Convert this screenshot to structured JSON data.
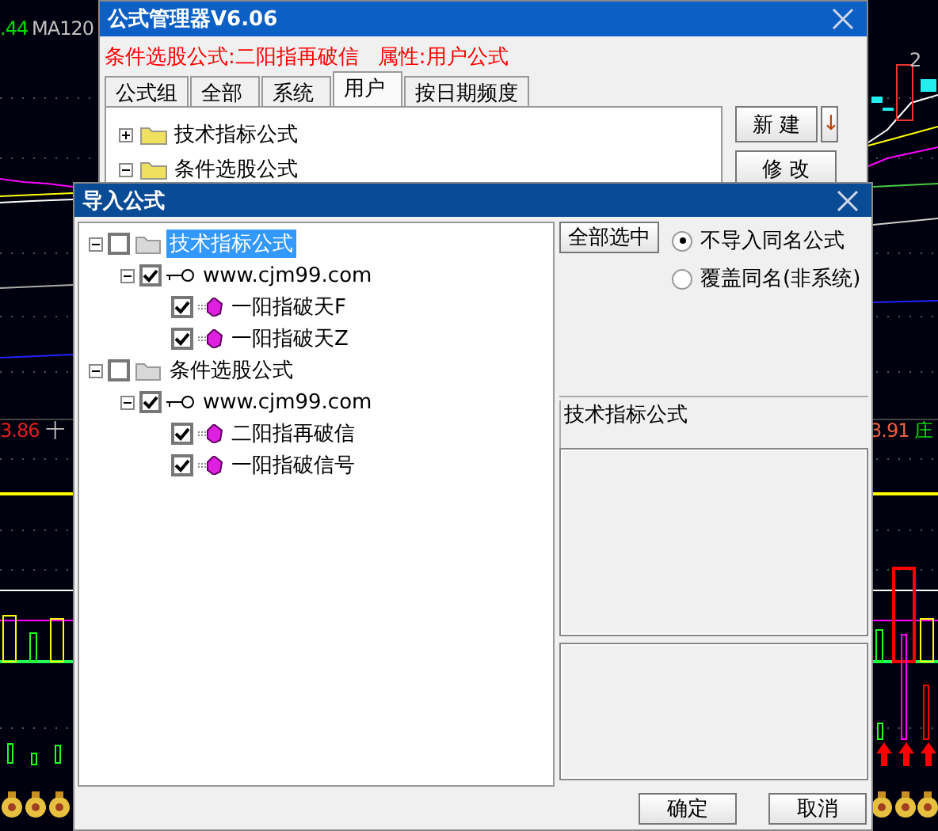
{
  "chart": {
    "labels": [
      {
        "text": ".44",
        "color": "#00e000"
      },
      {
        "text": "MA120",
        "color": "#c0c0c0"
      },
      {
        "text": "2",
        "color": "#c0c0c0"
      },
      {
        "text": "3.86",
        "color": "#e02020"
      },
      {
        "text": "十",
        "color": "#c0c0c0"
      },
      {
        "text": "3.91",
        "color": "#f06040"
      },
      {
        "text": "庄",
        "color": "#00e000"
      }
    ]
  },
  "manager": {
    "title": "公式管理器V6.06",
    "info": "条件选股公式:二阳指再破信",
    "attribute": "属性:用户公式",
    "tabs": [
      {
        "label": "公式组",
        "selected": false
      },
      {
        "label": "全部",
        "selected": false
      },
      {
        "label": "系统",
        "selected": false
      },
      {
        "label": "用户",
        "selected": true
      },
      {
        "label": "按日期频度",
        "selected": false
      }
    ],
    "tree": [
      {
        "label": "技术指标公式",
        "expanded": false
      },
      {
        "label": "条件选股公式",
        "expanded": true
      }
    ],
    "buttons": [
      {
        "label": "新 建",
        "kind": "wide"
      },
      {
        "label": "↓",
        "kind": "narrow"
      },
      {
        "label": "修 改",
        "kind": "full"
      }
    ]
  },
  "import": {
    "title": "导入公式",
    "tree": [
      {
        "kind": "folder",
        "label": "技术指标公式",
        "checked": false,
        "selected": true,
        "expanded": true,
        "children": [
          {
            "kind": "site",
            "label": "www.cjm99.com",
            "checked": true,
            "selected": false,
            "expanded": true,
            "children": [
              {
                "kind": "formula",
                "label": "一阳指破天F",
                "checked": true,
                "selected": false
              },
              {
                "kind": "formula",
                "label": "一阳指破天Z",
                "checked": true,
                "selected": false
              }
            ]
          }
        ]
      },
      {
        "kind": "folder",
        "label": "条件选股公式",
        "checked": false,
        "selected": false,
        "expanded": true,
        "children": [
          {
            "kind": "site",
            "label": "www.cjm99.com",
            "checked": true,
            "selected": false,
            "expanded": true,
            "children": [
              {
                "kind": "formula",
                "label": "二阳指再破信",
                "checked": true,
                "selected": false
              },
              {
                "kind": "formula",
                "label": "一阳指破信号",
                "checked": true,
                "selected": false
              }
            ]
          }
        ]
      }
    ],
    "select_all": "全部选中",
    "options": [
      {
        "label": "不导入同名公式",
        "selected": true
      },
      {
        "label": "覆盖同名(非系统)",
        "selected": false
      }
    ],
    "description_label": "技术指标公式",
    "ok": "确定",
    "cancel": "取消"
  }
}
